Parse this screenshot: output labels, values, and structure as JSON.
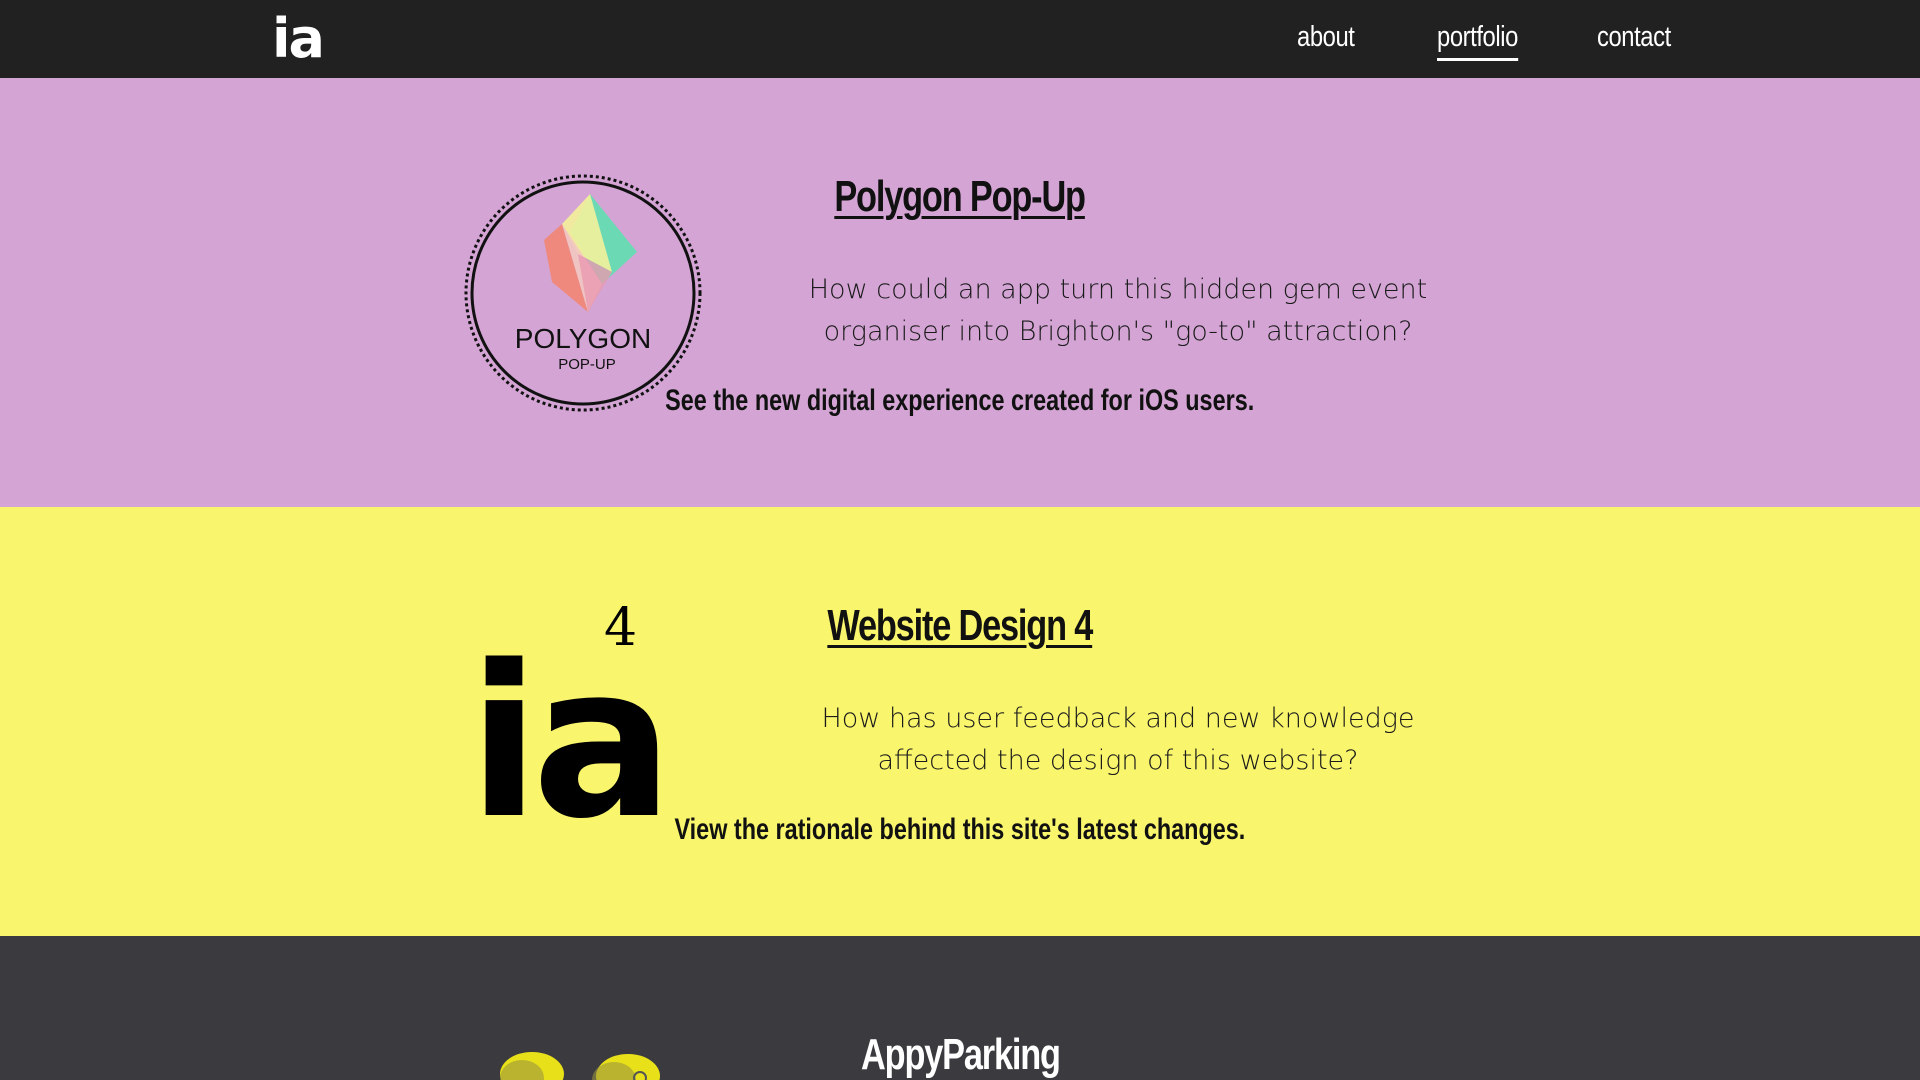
{
  "nav": {
    "brand": "ia",
    "links": [
      {
        "label": "about",
        "active": false
      },
      {
        "label": "portfolio",
        "active": true
      },
      {
        "label": "contact",
        "active": false
      }
    ]
  },
  "projects": [
    {
      "title": "Polygon Pop-Up",
      "desc_line1": "How could an app turn this hidden gem event",
      "desc_line2": "organiser into Brighton's \"go-to\" attraction?",
      "cta": "See the new digital experience created for iOS users.",
      "logo_line1": "POLYGON",
      "logo_line2": "POP-UP",
      "bg": "#d3a4d4"
    },
    {
      "title": "Website Design 4",
      "desc_line1": "How has user feedback and new knowledge",
      "desc_line2": "affected the design of this website?",
      "cta": "View the rationale behind this site's latest changes.",
      "logo_text": "ia",
      "logo_sup": "4",
      "bg": "#f9f56d"
    },
    {
      "title": "AppyParking",
      "bg": "#3b3b3f"
    }
  ],
  "colors": {
    "nav_bg": "#212121",
    "polygon_teal": "#5fe0b0",
    "polygon_yellow": "#f4f19a",
    "polygon_coral": "#f08878",
    "appy_yellow": "#e8e018"
  }
}
